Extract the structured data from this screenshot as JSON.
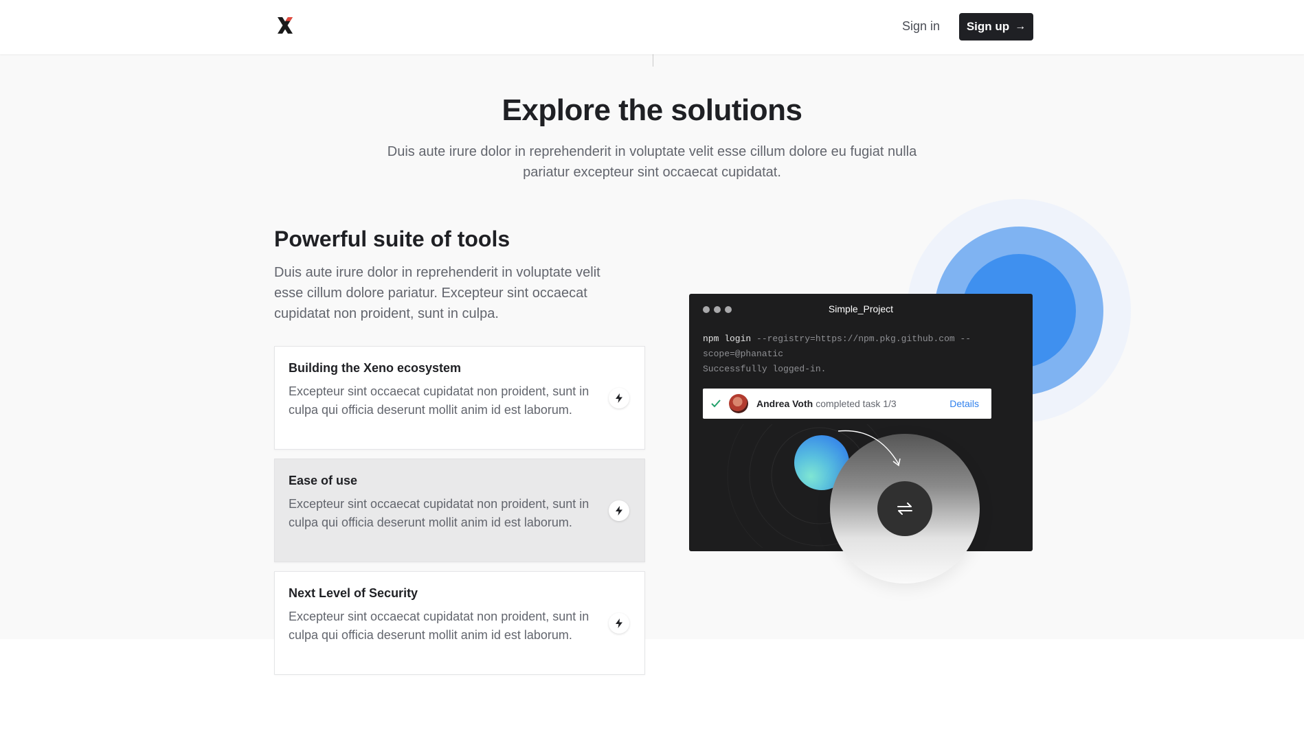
{
  "header": {
    "logo_icon": "x-logo-icon",
    "signin_label": "Sign in",
    "signup_label": "Sign up",
    "signup_icon": "arrow-right-icon"
  },
  "hero": {
    "title": "Explore the solutions",
    "subtitle": "Duis aute irure dolor in reprehenderit in voluptate velit esse cillum dolore eu fugiat nulla pariatur excepteur sint occaecat cupidatat."
  },
  "tools": {
    "heading": "Powerful suite of tools",
    "lead": "Duis aute irure dolor in reprehenderit in voluptate velit esse cillum dolore pariatur. Excepteur sint occaecat cupidatat non proident, sunt in culpa.",
    "items": [
      {
        "title": "Building the Xeno ecosystem",
        "description": "Excepteur sint occaecat cupidatat non proident, sunt in culpa qui officia deserunt mollit anim id est laborum.",
        "icon": "lightning-icon",
        "active": false
      },
      {
        "title": "Ease of use",
        "description": "Excepteur sint occaecat cupidatat non proident, sunt in culpa qui officia deserunt mollit anim id est laborum.",
        "icon": "lightning-icon",
        "active": true
      },
      {
        "title": "Next Level of Security",
        "description": "Excepteur sint occaecat cupidatat non proident, sunt in culpa qui officia deserunt mollit anim id est laborum.",
        "icon": "lightning-icon",
        "active": false
      }
    ]
  },
  "terminal": {
    "title": "Simple_Project",
    "command": "npm login",
    "args_line1": " --registry=https://npm.pkg.github.com --",
    "args_line2": "scope=@phanatic",
    "output": "Successfully logged-in.",
    "notification": {
      "name": "Andrea Voth",
      "text": "completed task 1/3",
      "action": "Details"
    }
  },
  "colors": {
    "accent": "#1f2024",
    "link": "#2f80ed",
    "blob_light": "#7fb3f2",
    "blob_dark": "#3f90ef"
  }
}
